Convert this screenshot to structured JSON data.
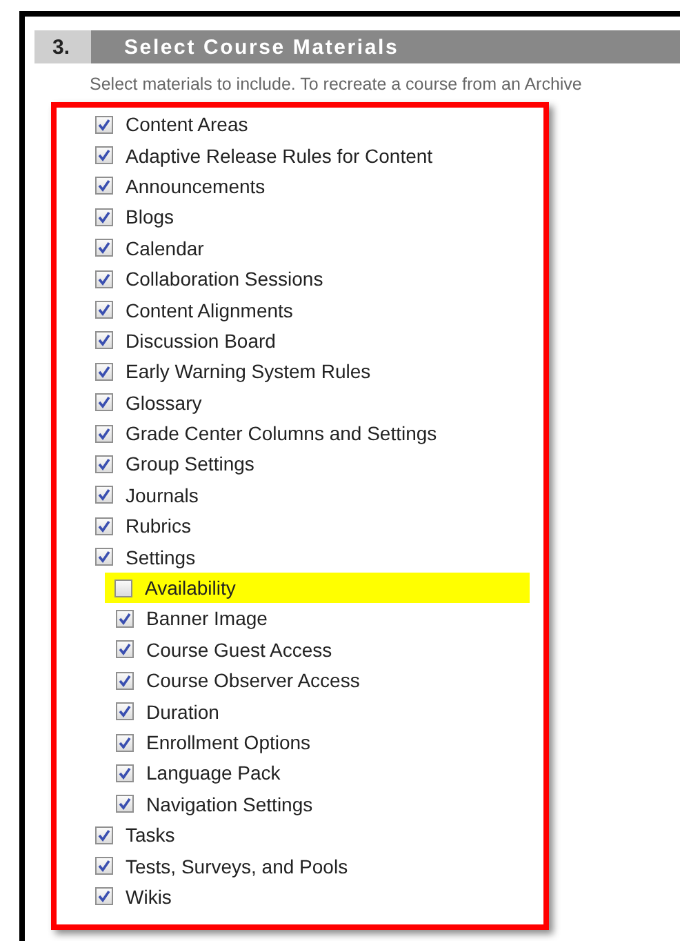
{
  "section": {
    "number": "3.",
    "title": "Select Course Materials"
  },
  "description": "Select materials to include. To recreate a course from an Archive",
  "items": [
    {
      "label": "Content Areas",
      "checked": true,
      "highlighted": false
    },
    {
      "label": "Adaptive Release Rules for Content",
      "checked": true,
      "highlighted": false
    },
    {
      "label": "Announcements",
      "checked": true,
      "highlighted": false
    },
    {
      "label": "Blogs",
      "checked": true,
      "highlighted": false
    },
    {
      "label": "Calendar",
      "checked": true,
      "highlighted": false
    },
    {
      "label": "Collaboration Sessions",
      "checked": true,
      "highlighted": false
    },
    {
      "label": "Content Alignments",
      "checked": true,
      "highlighted": false
    },
    {
      "label": "Discussion Board",
      "checked": true,
      "highlighted": false
    },
    {
      "label": "Early Warning System Rules",
      "checked": true,
      "highlighted": false
    },
    {
      "label": "Glossary",
      "checked": true,
      "highlighted": false
    },
    {
      "label": "Grade Center Columns and Settings",
      "checked": true,
      "highlighted": false
    },
    {
      "label": "Group Settings",
      "checked": true,
      "highlighted": false
    },
    {
      "label": "Journals",
      "checked": true,
      "highlighted": false
    },
    {
      "label": "Rubrics",
      "checked": true,
      "highlighted": false
    },
    {
      "label": "Settings",
      "checked": true,
      "highlighted": false,
      "children": [
        {
          "label": "Availability",
          "checked": false,
          "highlighted": true
        },
        {
          "label": "Banner Image",
          "checked": true,
          "highlighted": false
        },
        {
          "label": "Course Guest Access",
          "checked": true,
          "highlighted": false
        },
        {
          "label": "Course Observer Access",
          "checked": true,
          "highlighted": false
        },
        {
          "label": "Duration",
          "checked": true,
          "highlighted": false
        },
        {
          "label": "Enrollment Options",
          "checked": true,
          "highlighted": false
        },
        {
          "label": "Language Pack",
          "checked": true,
          "highlighted": false
        },
        {
          "label": "Navigation Settings",
          "checked": true,
          "highlighted": false
        }
      ]
    },
    {
      "label": "Tasks",
      "checked": true,
      "highlighted": false
    },
    {
      "label": "Tests, Surveys, and Pools",
      "checked": true,
      "highlighted": false
    },
    {
      "label": "Wikis",
      "checked": true,
      "highlighted": false
    }
  ]
}
